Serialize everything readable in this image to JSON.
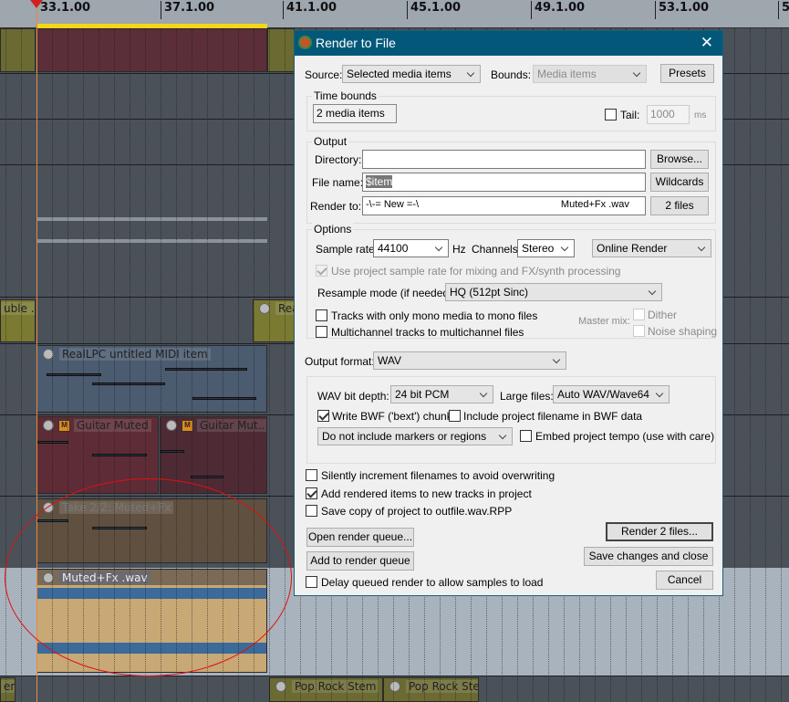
{
  "ruler": {
    "marks": [
      "33.1.00",
      "37.1.00",
      "41.1.00",
      "45.1.00",
      "49.1.00",
      "53.1.00",
      "5"
    ]
  },
  "arrange": {
    "items": {
      "double": "uble ...",
      "real": "Rea",
      "midi": "RealLPC untitled MIDI item",
      "guitar1": "Guitar Muted",
      "guitar2": "Guitar Mut...",
      "take": "Take 2/2: Muted+Fx",
      "wav": "Muted+Fx .wav",
      "stem0": "em",
      "stem1": "Pop Rock Stem",
      "stem2": "Pop Rock Stem"
    },
    "mute_badge": "M"
  },
  "dialog": {
    "title": "Render to File",
    "close": "✕",
    "source_label": "Source:",
    "source_value": "Selected media items",
    "bounds_label": "Bounds:",
    "bounds_value": "Media items",
    "presets": "Presets",
    "time_bounds": {
      "title": "Time bounds",
      "value": "2 media items",
      "tail_label": "Tail:",
      "tail_value": "1000",
      "tail_unit": "ms",
      "tail_checked": false
    },
    "output": {
      "title": "Output",
      "directory_label": "Directory:",
      "directory_value": "",
      "browse": "Browse...",
      "filename_label": "File name:",
      "filename_value": "$item",
      "wildcards": "Wildcards",
      "renderto_label": "Render to:",
      "renderto_value": "-\\-= New =-\\                                                   Muted+Fx .wav",
      "files_button": "2 files"
    },
    "options": {
      "title": "Options",
      "sample_rate_label": "Sample rate:",
      "sample_rate": "44100",
      "hz": "Hz",
      "channels_label": "Channels:",
      "channels": "Stereo",
      "render_mode": "Online Render",
      "use_project_rate": "Use project sample rate for mixing and FX/synth processing",
      "resample_label": "Resample mode (if needed):",
      "resample": "HQ (512pt Sinc)",
      "mono": "Tracks with only mono media to mono files",
      "multichannel": "Multichannel tracks to multichannel files",
      "master_mix": "Master mix:",
      "dither": "Dither",
      "noise_shaping": "Noise shaping"
    },
    "format_label": "Output format:",
    "format": "WAV",
    "wav": {
      "bit_depth_label": "WAV bit depth:",
      "bit_depth": "24 bit PCM",
      "large_label": "Large files:",
      "large": "Auto WAV/Wave64",
      "bwf": "Write BWF ('bext') chunk",
      "bwf_checked": true,
      "include_filename": "Include project filename in BWF data",
      "markers": "Do not include markers or regions",
      "embed_tempo": "Embed project tempo (use with care)"
    },
    "silently": "Silently increment filenames to avoid overwriting",
    "add_rendered": "Add rendered items to new tracks in project",
    "add_rendered_checked": true,
    "save_copy": "Save copy of project to outfile.wav.RPP",
    "open_queue": "Open render queue...",
    "add_queue": "Add to render queue",
    "delay": "Delay queued render to allow samples to load",
    "render": "Render 2 files...",
    "save_close": "Save changes and close",
    "cancel": "Cancel"
  },
  "colors": {
    "titlebar": "#03587a",
    "annotation": "#e01010",
    "loop": "#f2d61a"
  }
}
